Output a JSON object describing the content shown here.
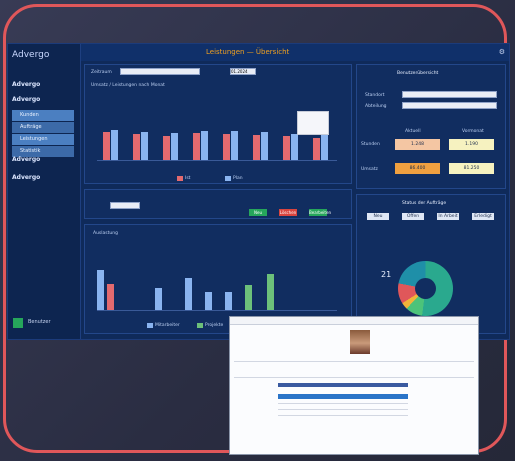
{
  "app": {
    "logo": "Advergo",
    "title": "Leistungen — Übersicht",
    "user_label": "Benutzer"
  },
  "sidebar": {
    "items": [
      {
        "label": "Advergo"
      },
      {
        "label": "Advergo"
      },
      {
        "label": "Advergo"
      },
      {
        "label": "Advergo"
      }
    ],
    "subitems": [
      "Kunden",
      "Aufträge",
      "Leistungen",
      "Statistik"
    ]
  },
  "filters": {
    "label": "Zeitraum",
    "date_value": "01.2024"
  },
  "chart1": {
    "title": "Umsatz / Leistungen nach Monat",
    "legend": [
      "Ist",
      "Plan"
    ],
    "colors": {
      "ist": "#e36a6f",
      "plan": "#8ab4f0"
    }
  },
  "chart2": {
    "title": "Auslastung",
    "legend": [
      "Mitarbeiter",
      "Projekte"
    ]
  },
  "right_panel": {
    "title": "Benutzerübersicht",
    "fields": [
      "Standort",
      "Abteilung"
    ],
    "col_heads": [
      "Aktuell",
      "Vormonat"
    ],
    "rows": [
      {
        "label": "Stunden",
        "v1": "1.248",
        "v2": "1.190"
      },
      {
        "label": "Umsatz",
        "v1": "86.400",
        "v2": "81.250"
      }
    ]
  },
  "status": {
    "title": "Status der Aufträge",
    "labels": [
      "Neu",
      "Offen",
      "In Arbeit",
      "Erledigt"
    ],
    "center_value": "21"
  },
  "buttons": [
    "Neu",
    "Bearbeiten",
    "Löschen"
  ]
}
